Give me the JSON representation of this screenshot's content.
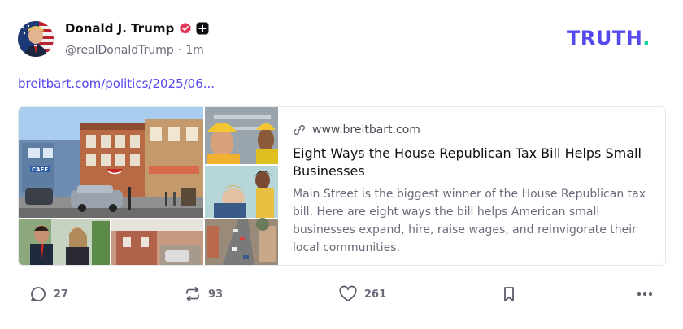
{
  "author": {
    "display_name": "Donald J. Trump",
    "handle": "@realDonaldTrump",
    "separator": "·",
    "timestamp": "1m",
    "verified_badge_icon": "verified-badge-icon",
    "premium_badge_icon": "plus-badge-icon"
  },
  "brand": {
    "name": "TRUTH",
    "dot": ".",
    "color": "#5448ee",
    "dot_color": "#0cd2a0"
  },
  "post": {
    "link_text": "breitbart.com/politics/2025/06..."
  },
  "link_card": {
    "icon": "link-icon",
    "domain": "www.breitbart.com",
    "title": "Eight Ways the House Republican Tax Bill Helps Small Businesses",
    "description": "Main Street is the biggest winner of the House Republican tax bill. Here are eight ways the bill helps American small businesses expand, hire, raise wages, and reinvigorate their local communities.",
    "image_sign_text": "CAFE"
  },
  "actions": {
    "reply": {
      "icon": "reply-icon",
      "count": "27"
    },
    "retruth": {
      "icon": "retruth-icon",
      "count": "93"
    },
    "like": {
      "icon": "heart-icon",
      "count": "261"
    },
    "bookmark": {
      "icon": "bookmark-icon"
    },
    "more": {
      "icon": "more-icon"
    }
  },
  "colors": {
    "accent": "#5448ee",
    "muted_text": "#6b6b7b",
    "verified_badge": "#e0365a"
  }
}
